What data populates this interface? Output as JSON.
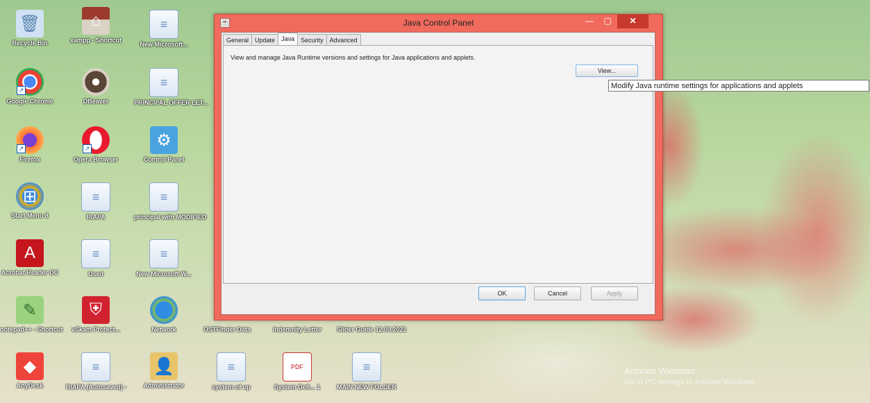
{
  "window": {
    "title": "Java Control Panel",
    "tabs": [
      {
        "label": "General"
      },
      {
        "label": "Update"
      },
      {
        "label": "Java"
      },
      {
        "label": "Security"
      },
      {
        "label": "Advanced"
      }
    ],
    "active_tab": "Java",
    "description": "View and manage Java Runtime versions and settings for Java applications and applets.",
    "view_button": "View...",
    "ok_button": "OK",
    "cancel_button": "Cancel",
    "apply_button": "Apply",
    "tooltip": "Modify Java runtime settings for applications and applets"
  },
  "desktop_icons": [
    {
      "label": "Recycle Bin",
      "icon": "recycle-bin-icon",
      "glyph": "🗑"
    },
    {
      "label": "Google Chrome",
      "icon": "chrome-icon",
      "glyph": "◉"
    },
    {
      "label": "Firefox",
      "icon": "firefox-icon",
      "glyph": "🦊"
    },
    {
      "label": "Start Menu 8",
      "icon": "start-menu-icon",
      "glyph": "⊞"
    },
    {
      "label": "Acrobat Reader DC",
      "icon": "acrobat-icon",
      "glyph": "A"
    },
    {
      "label": "notepad++ - Shortcut",
      "icon": "notepad-icon",
      "glyph": "✎"
    },
    {
      "label": "AnyDesk",
      "icon": "anydesk-icon",
      "glyph": "◆"
    },
    {
      "label": "xampp - Shortcut",
      "icon": "xampp-icon",
      "glyph": "⌂"
    },
    {
      "label": "DBeaver",
      "icon": "dbeaver-icon",
      "glyph": "●"
    },
    {
      "label": "Opera Browser",
      "icon": "opera-icon",
      "glyph": "O"
    },
    {
      "label": "RIAPA",
      "icon": "document-icon",
      "glyph": "≡"
    },
    {
      "label": "Used",
      "icon": "document-icon",
      "glyph": "≡"
    },
    {
      "label": "vSkam Protect...",
      "icon": "shield-app-icon",
      "glyph": "⛨"
    },
    {
      "label": "RIAPA (Autosaved) -",
      "icon": "document-icon",
      "glyph": "≡"
    },
    {
      "label": "New Microsoft...",
      "icon": "document-icon",
      "glyph": "≡"
    },
    {
      "label": "PRINCIPAL OFFER LET...",
      "icon": "document-icon",
      "glyph": "≡"
    },
    {
      "label": "Control Panel",
      "icon": "control-panel-icon",
      "glyph": "⚙"
    },
    {
      "label": "principal with MODIFIED",
      "icon": "document-icon",
      "glyph": "≡"
    },
    {
      "label": "New Microsoft W...",
      "icon": "document-icon",
      "glyph": "≡"
    },
    {
      "label": "Network",
      "icon": "network-icon",
      "glyph": "🌐"
    },
    {
      "label": "Administrator",
      "icon": "user-folder-icon",
      "glyph": "👤"
    },
    {
      "label": "OSTFinder Data",
      "icon": "folder-icon",
      "glyph": "▤"
    },
    {
      "label": "system of up",
      "icon": "document-icon",
      "glyph": "≡"
    },
    {
      "label": "Indemnity Letter",
      "icon": "document-icon",
      "glyph": "≡"
    },
    {
      "label": "System Defi... 1",
      "icon": "pdf-icon",
      "glyph": "PDF"
    },
    {
      "label": "Slider Guide 12.09.2021",
      "icon": "document-icon",
      "glyph": "≡"
    },
    {
      "label": "MAIN NEW FOLDER",
      "icon": "document-icon",
      "glyph": "≡"
    }
  ],
  "watermark": {
    "line1": "Activate Windows",
    "line2": "Go to PC settings to activate Windows."
  },
  "colors": {
    "window_frame": "#f06a5d",
    "close_button": "#c7392c",
    "tooltip_border": "#767676"
  }
}
